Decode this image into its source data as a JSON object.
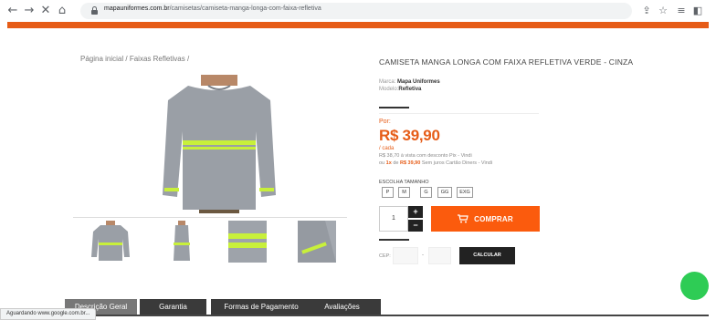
{
  "browser": {
    "url_domain": "mapauniformes.com.br",
    "url_path": "/camisetas/camiseta-manga-longa-com-faixa-refletiva"
  },
  "breadcrumb": {
    "home": "Página inicial",
    "category": "Faixas Refletivas",
    "sep": "/"
  },
  "product": {
    "title": "CAMISETA MANGA LONGA COM FAIXA REFLETIVA VERDE - CINZA",
    "brand_label": "Marca:",
    "brand": "Mapa Uniformes",
    "model_label": "Modelo:",
    "model": "Refletiva",
    "price_prefix": "Por:",
    "price": "R$ 39,90",
    "per_unit": "/ cada",
    "pix_line": "R$ 38,70 à vista com desconto Pix - Vindi",
    "installment_prefix": "ou",
    "installment_count": "1x",
    "installment_mid": "de",
    "installment_value": "R$ 39,90",
    "installment_suffix": "Sem juros Cartão Diners - Vindi",
    "size_label": "ESCOLHA TAMANHO",
    "sizes": [
      "P",
      "M",
      "G",
      "GG",
      "EXG"
    ],
    "quantity": "1",
    "buy_label": "COMPRAR",
    "cep_label": "CEP:",
    "calc_label": "CALCULAR"
  },
  "tabs": [
    "Descrição Geral",
    "Garantia",
    "Formas de Pagamento",
    "Avaliações"
  ],
  "status_text": "Aguardando www.google.com.br...",
  "colors": {
    "accent": "#e65c17",
    "buy_button": "#fb5b0d",
    "shirt": "#9a9fa6",
    "reflective_stripe": "#c8f03a",
    "fab": "#2ecc55"
  }
}
